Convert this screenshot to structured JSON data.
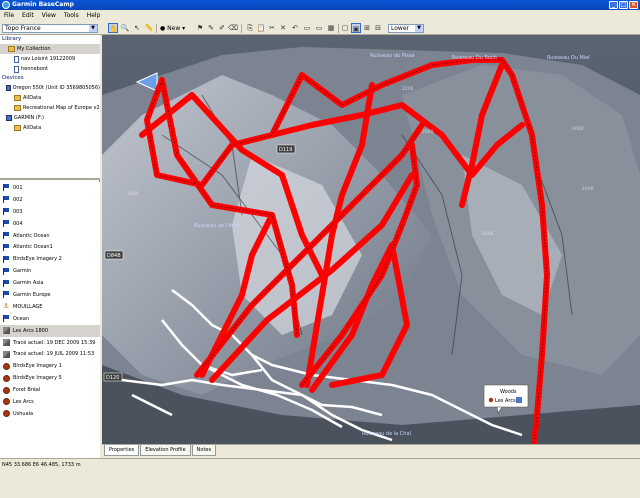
{
  "window": {
    "title": "Garmin BaseCamp"
  },
  "menu": [
    "File",
    "Edit",
    "View",
    "Tools",
    "Help"
  ],
  "toolbar": {
    "map_product": "Topo France",
    "new_label": "New",
    "detail_level": "Lower"
  },
  "library": {
    "label": "Library",
    "items": [
      "My Collection",
      "nav Loisint 19122009",
      "hennebont"
    ]
  },
  "devices": {
    "label": "Devices",
    "items": [
      "Oregon 550t (Unit ID 3569805056)",
      "AllData",
      "Recreational Map of Europe v2",
      "GARMIN (F:)",
      "AllData"
    ]
  },
  "list": [
    {
      "type": "flag",
      "name": "001"
    },
    {
      "type": "flag",
      "name": "002"
    },
    {
      "type": "flag",
      "name": "003"
    },
    {
      "type": "flag",
      "name": "004"
    },
    {
      "type": "flag",
      "name": "Atlantic Ocean"
    },
    {
      "type": "flag",
      "name": "Atlantic Ocean1"
    },
    {
      "type": "flag",
      "name": "BirdsEye Imagery 2"
    },
    {
      "type": "flag",
      "name": "Garmin"
    },
    {
      "type": "flag",
      "name": "Garmin Asia"
    },
    {
      "type": "flag",
      "name": "Garmin Europe"
    },
    {
      "type": "anchor",
      "name": "MOUILLAGE"
    },
    {
      "type": "flag",
      "name": "Ocean"
    },
    {
      "type": "track",
      "name": "Les Arcs 1800"
    },
    {
      "type": "track",
      "name": "Tracé actuel: 19 DEC 2009 15:39"
    },
    {
      "type": "track",
      "name": "Tracé actuel: 19 JUIL 2009 11:53"
    },
    {
      "type": "dot",
      "name": "BirdsEye Imagery 1"
    },
    {
      "type": "dot",
      "name": "BirdsEye Imagery 5"
    },
    {
      "type": "dot",
      "name": "Foret Bréal"
    },
    {
      "type": "dot",
      "name": "Les Arcs"
    },
    {
      "type": "dot",
      "name": "Ushuaia"
    }
  ],
  "map": {
    "labels": [
      "Ruisseau du Pissa",
      "Ruisseau Du Roch",
      "Ruisseau Du Miel",
      "D119",
      "Ruisseau de l'Arbin",
      "D84B",
      "D120",
      "Ruisseau de la Chal",
      "2000",
      "2200",
      "1800",
      "1600",
      "2600",
      "2400"
    ],
    "popup": {
      "title": "Woods",
      "item": "Les Arcs"
    },
    "colors": {
      "track": "#ff0000",
      "road": "#ffffff",
      "terrain": "#3b4350"
    }
  },
  "tabs": [
    "Properties",
    "Elevation Profile",
    "Notes"
  ],
  "status": {
    "coords": "N45 33.686 E6 46.485, 1733 m"
  }
}
